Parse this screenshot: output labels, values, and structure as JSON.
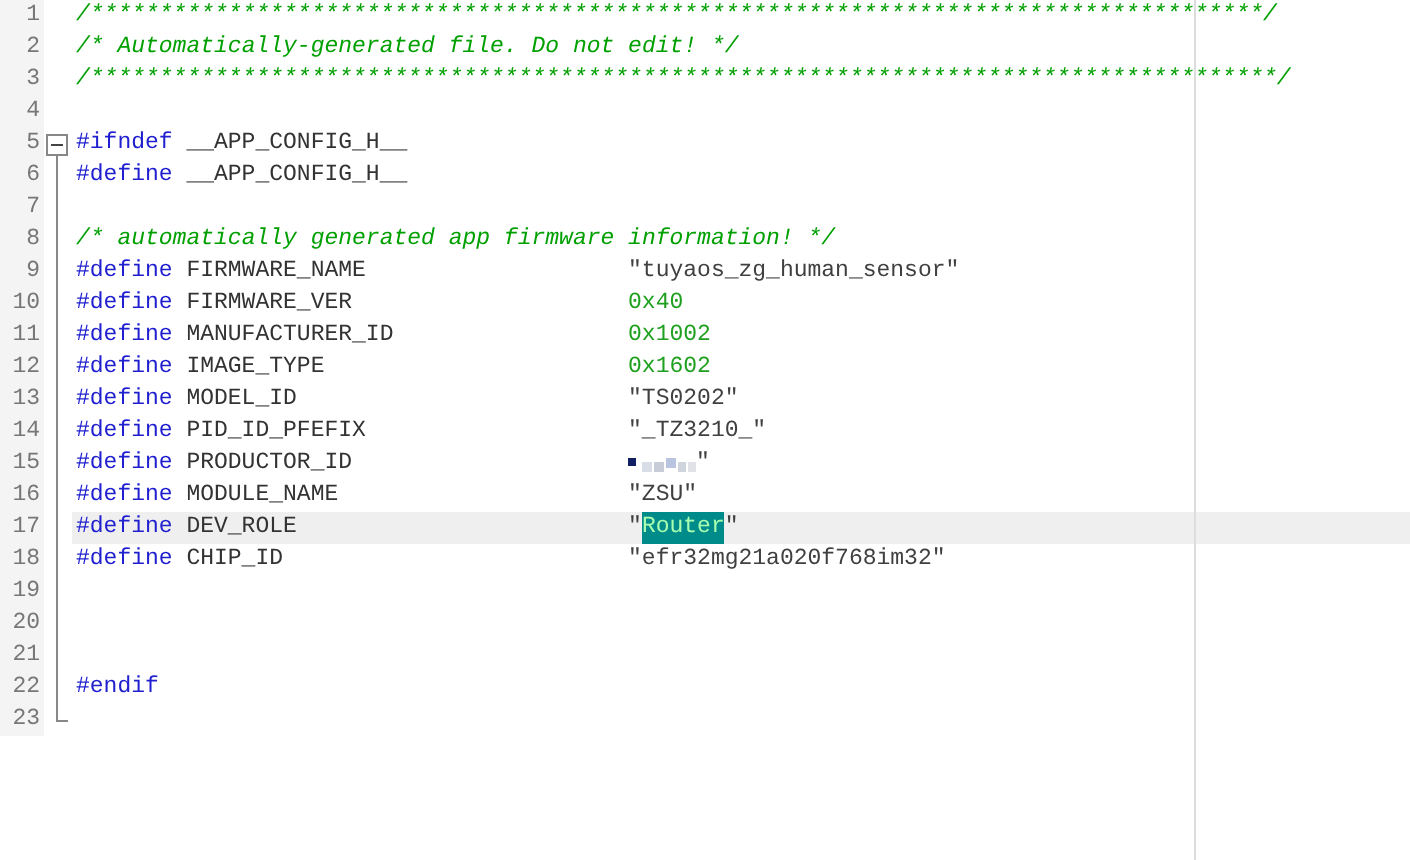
{
  "editor": {
    "lines": [
      {
        "number": "1",
        "kind": "comment",
        "text": "/*************************************************************************************/",
        "current": false
      },
      {
        "number": "2",
        "kind": "comment",
        "text": "/* Automatically-generated file. Do not edit! */",
        "current": false
      },
      {
        "number": "3",
        "kind": "comment",
        "text": "/**************************************************************************************/",
        "current": false
      },
      {
        "number": "4",
        "kind": "blank",
        "current": false
      },
      {
        "number": "5",
        "kind": "directive",
        "keyword": "#ifndef",
        "name": "__APP_CONFIG_H__",
        "fold": {
          "kind": "start"
        },
        "current": false
      },
      {
        "number": "6",
        "kind": "directive",
        "keyword": "#define",
        "name": "__APP_CONFIG_H__",
        "current": false
      },
      {
        "number": "7",
        "kind": "blank",
        "current": false
      },
      {
        "number": "8",
        "kind": "comment",
        "text": "/* automatically generated app firmware information! */",
        "current": false
      },
      {
        "number": "9",
        "kind": "define",
        "keyword": "#define",
        "name": "FIRMWARE_NAME",
        "value": {
          "kind": "string",
          "text": "\"tuyaos_zg_human_sensor\""
        },
        "current": false
      },
      {
        "number": "10",
        "kind": "define",
        "keyword": "#define",
        "name": "FIRMWARE_VER",
        "value": {
          "kind": "number",
          "text": "0x40"
        },
        "current": false
      },
      {
        "number": "11",
        "kind": "define",
        "keyword": "#define",
        "name": "MANUFACTURER_ID",
        "value": {
          "kind": "number",
          "text": "0x1002"
        },
        "current": false
      },
      {
        "number": "12",
        "kind": "define",
        "keyword": "#define",
        "name": "IMAGE_TYPE",
        "value": {
          "kind": "number",
          "text": "0x1602"
        },
        "current": false
      },
      {
        "number": "13",
        "kind": "define",
        "keyword": "#define",
        "name": "MODEL_ID",
        "value": {
          "kind": "string",
          "text": "\"TS0202\""
        },
        "current": false
      },
      {
        "number": "14",
        "kind": "define",
        "keyword": "#define",
        "name": "PID_ID_PFEFIX",
        "value": {
          "kind": "string",
          "text": "\"_TZ3210_\""
        },
        "current": false
      },
      {
        "number": "15",
        "kind": "define",
        "keyword": "#define",
        "name": "PRODUCTOR_ID",
        "value": {
          "kind": "redacted",
          "text": "\""
        },
        "current": false
      },
      {
        "number": "16",
        "kind": "define",
        "keyword": "#define",
        "name": "MODULE_NAME",
        "value": {
          "kind": "string",
          "text": "\"ZSU\""
        },
        "current": false
      },
      {
        "number": "17",
        "kind": "define",
        "keyword": "#define",
        "name": "DEV_ROLE",
        "value": {
          "kind": "string",
          "parts": [
            {
              "text": "\"",
              "selected": false
            },
            {
              "text": "Router",
              "selected": true
            },
            {
              "text": "\"",
              "selected": false
            }
          ]
        },
        "current": true
      },
      {
        "number": "18",
        "kind": "define",
        "keyword": "#define",
        "name": "CHIP_ID",
        "value": {
          "kind": "string",
          "text": "\"efr32mg21a020f768im32\""
        },
        "current": false
      },
      {
        "number": "19",
        "kind": "blank",
        "current": false
      },
      {
        "number": "20",
        "kind": "blank",
        "current": false
      },
      {
        "number": "21",
        "kind": "blank",
        "current": false
      },
      {
        "number": "22",
        "kind": "directive",
        "keyword": "#endif",
        "current": false
      },
      {
        "number": "23",
        "kind": "blank",
        "fold": {
          "kind": "end"
        },
        "current": false
      }
    ]
  }
}
